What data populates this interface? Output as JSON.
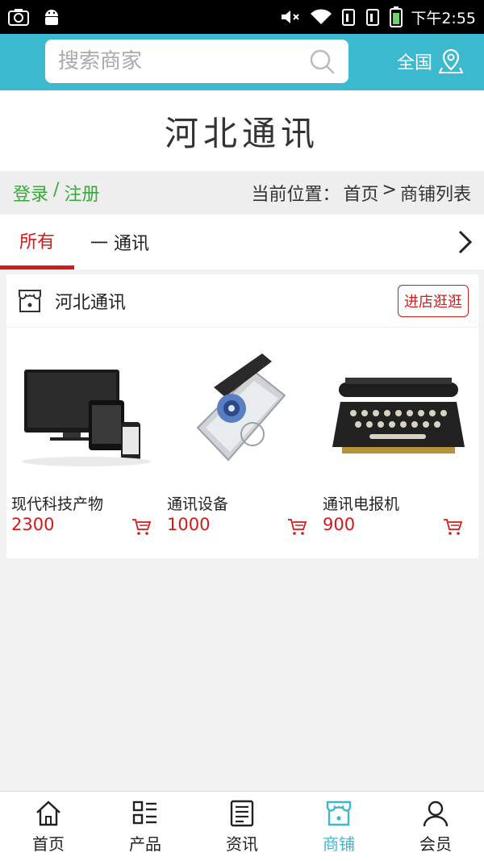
{
  "status_bar": {
    "time": "下午2:55"
  },
  "header": {
    "search_placeholder": "搜索商家",
    "region_label": "全国"
  },
  "banner": {
    "title": "河北通讯"
  },
  "login_bar": {
    "login": "登录",
    "separator": "/",
    "register": "注册",
    "location_prefix": "当前位置：",
    "crumb_home": "首页",
    "crumb_arrow": ">",
    "crumb_current": "商铺列表"
  },
  "tabs": {
    "all": "所有",
    "category": "一 通讯"
  },
  "shop": {
    "name": "河北通讯",
    "visit_button": "进店逛逛",
    "products": [
      {
        "name": "现代科技产物",
        "price": "2300"
      },
      {
        "name": "通讯设备",
        "price": "1000"
      },
      {
        "name": "通讯电报机",
        "price": "900"
      }
    ]
  },
  "bottom_nav": [
    {
      "label": "首页",
      "icon": "home-icon"
    },
    {
      "label": "产品",
      "icon": "grid-list-icon"
    },
    {
      "label": "资讯",
      "icon": "news-icon"
    },
    {
      "label": "商铺",
      "icon": "shop-icon"
    },
    {
      "label": "会员",
      "icon": "user-icon"
    }
  ],
  "colors": {
    "primary": "#3cb8cf",
    "accent_red": "#d21a1a",
    "login_green": "#3aa83a"
  }
}
